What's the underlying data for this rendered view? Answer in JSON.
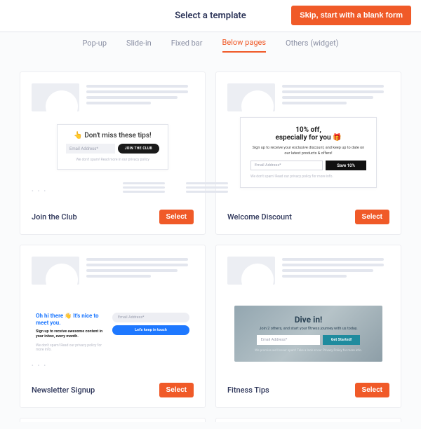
{
  "header": {
    "title": "Select a template",
    "skip_label": "Skip, start with a blank form"
  },
  "tabs": {
    "popup": "Pop-up",
    "slidein": "Slide-in",
    "fixedbar": "Fixed bar",
    "belowpages": "Below pages",
    "others": "Others (widget)"
  },
  "templates": {
    "join_club": {
      "name": "Join the Club",
      "select": "Select",
      "modal_title": "👆 Don't miss these tips!",
      "placeholder": "Email Address*",
      "cta": "JOIN THE CLUB",
      "footnote": "We don't spam! Read more in our privacy policy"
    },
    "welcome": {
      "name": "Welcome Discount",
      "select": "Select",
      "line1": "10% off,",
      "line2": "especially for you 🎁",
      "sub": "Sign up to receive your exclusive discount, and keep up to date on our latest products & offers!",
      "placeholder": "Email Address*",
      "cta": "Save 10%",
      "footnote": "We don't spam! Read our privacy policy for more info."
    },
    "newsletter": {
      "name": "Newsletter Signup",
      "select": "Select",
      "title": "Oh hi there 👋 It's nice to meet you.",
      "sub": "Sign up to receive awesome content in your inbox, every month.",
      "placeholder": "Email Address*",
      "cta": "Let's keep in touch",
      "footnote": "We don't spam! Read our privacy policy for more info."
    },
    "fitness": {
      "name": "Fitness Tips",
      "select": "Select",
      "title": "Dive in!",
      "sub": "Join 2 others, and start your fitness journey with us today.",
      "placeholder": "Email Address*",
      "cta": "Get Started!",
      "footnote": "We promise we'll never spam! Take a look at our Privacy Policy for more info."
    }
  }
}
